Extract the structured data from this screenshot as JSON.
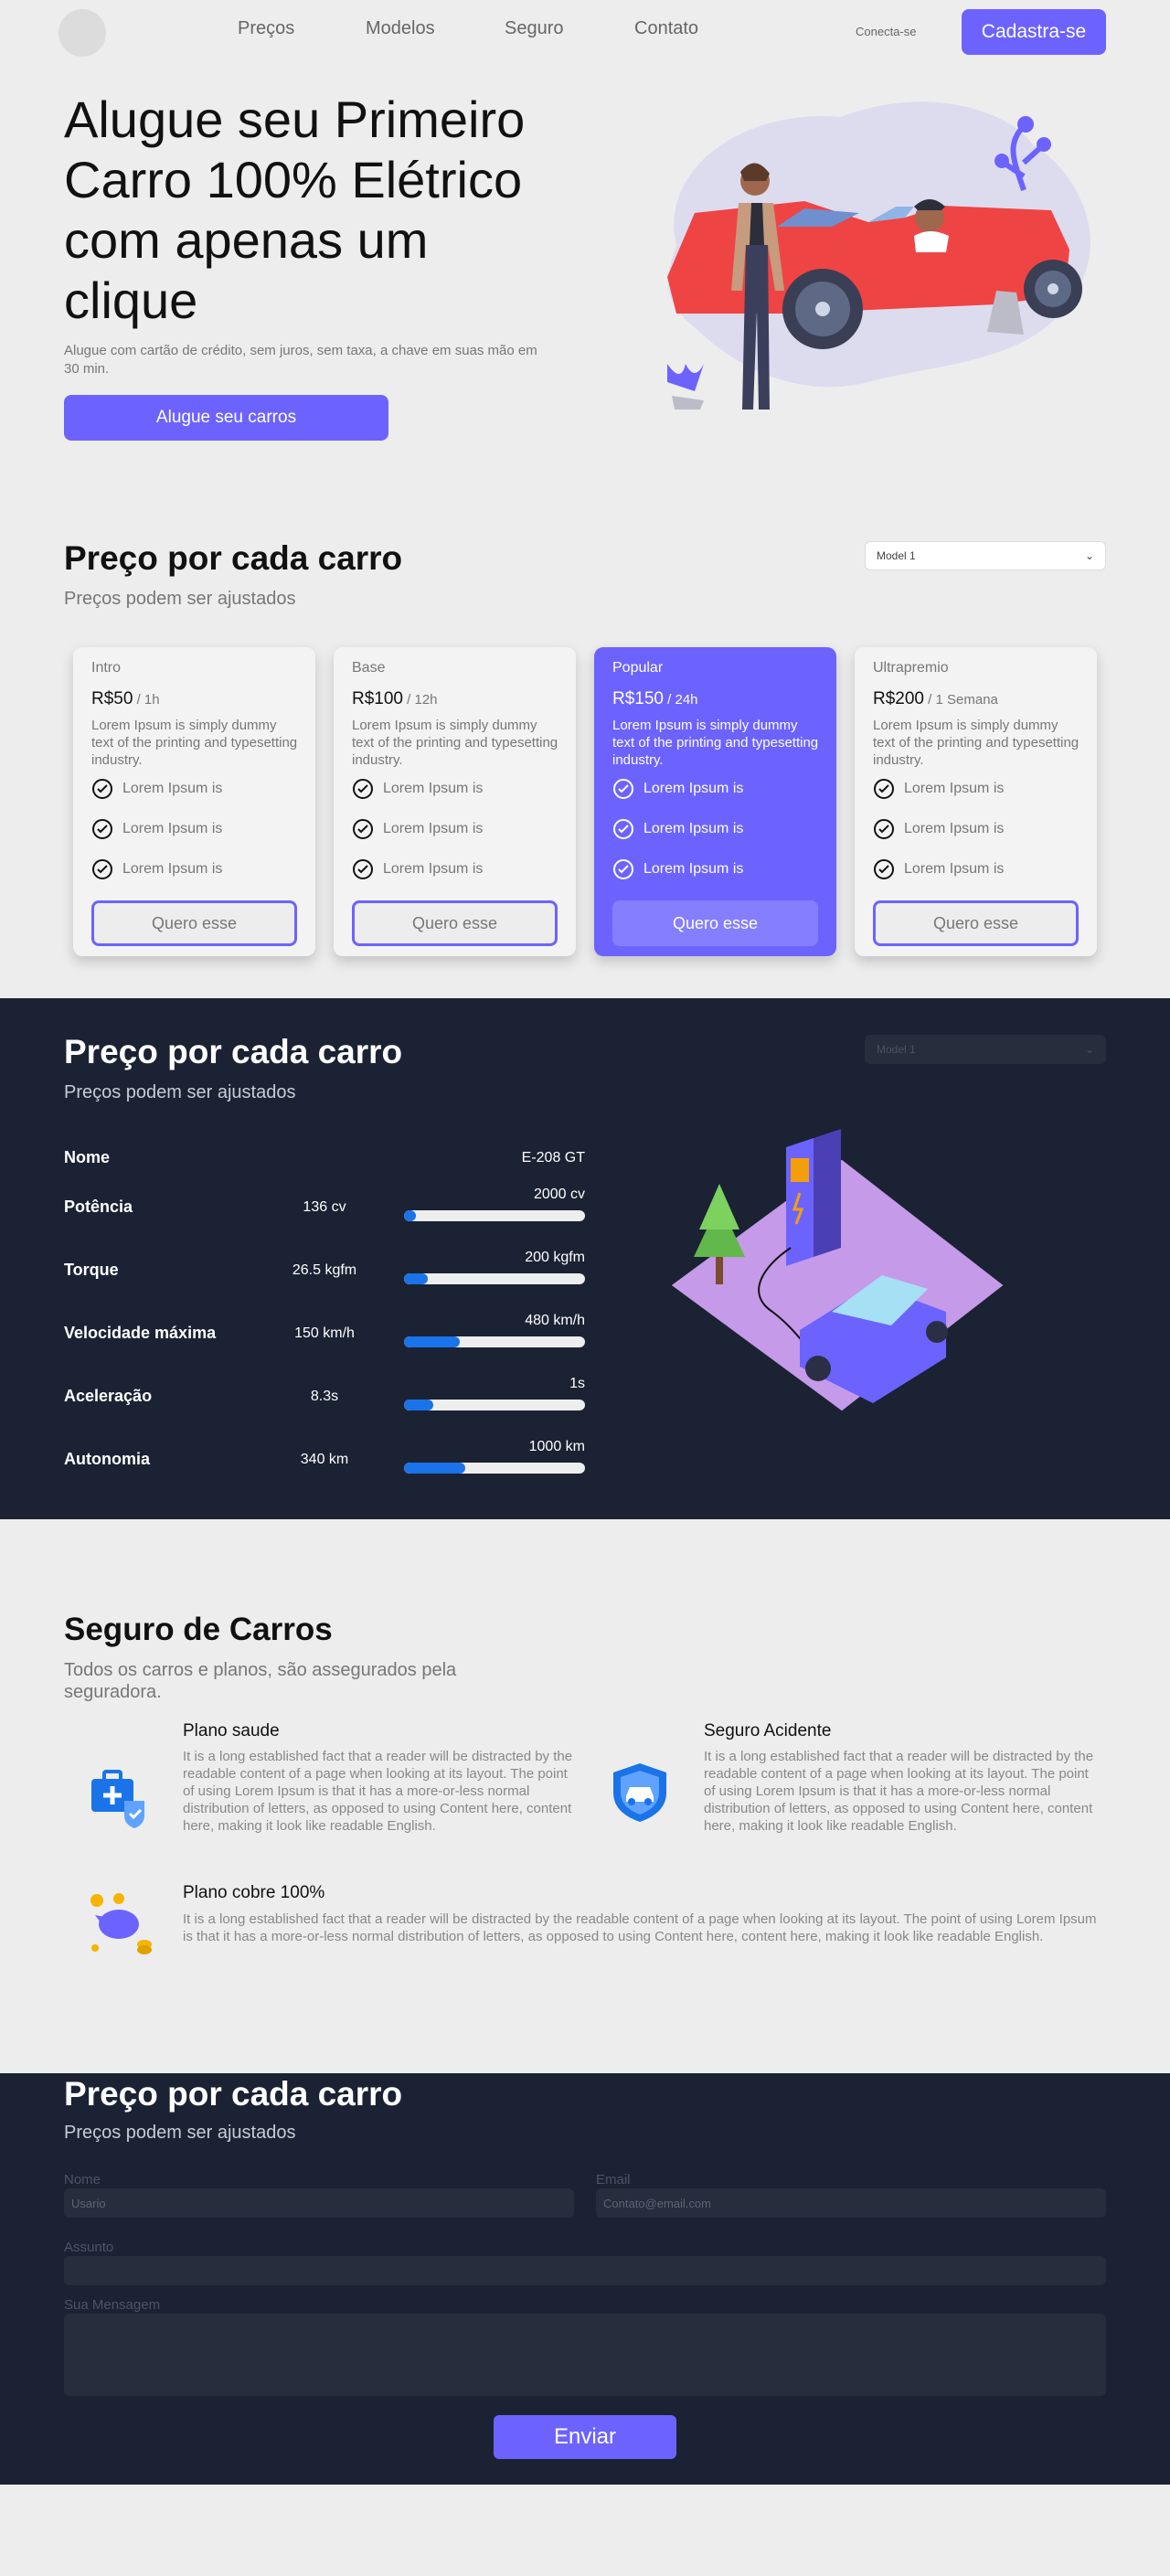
{
  "nav": {
    "links": [
      "Preços",
      "Modelos",
      "Seguro",
      "Contato"
    ],
    "login": "Conecta-se",
    "signup": "Cadastra-se"
  },
  "hero": {
    "title": "Alugue seu Primeiro Carro 100% Elétrico com apenas um clique",
    "subtitle": "Alugue com cartão de crédito, sem juros, sem taxa, a chave em suas mão em 30 min.",
    "button": "Alugue seu carros"
  },
  "pricing": {
    "title": "Preço por cada carro",
    "subtitle": "Preços podem ser ajustados",
    "select": "Model 1",
    "cards": [
      {
        "tier": "Intro",
        "price": "R$50",
        "period": " / 1h",
        "desc": "Lorem Ipsum is simply dummy text of the printing and typesetting industry.",
        "features": [
          "Lorem Ipsum is",
          "Lorem Ipsum is",
          "Lorem Ipsum is"
        ],
        "button": "Quero esse"
      },
      {
        "tier": "Base",
        "price": "R$100",
        "period": " / 12h",
        "desc": "Lorem Ipsum is simply dummy text of the printing and typesetting industry.",
        "features": [
          "Lorem Ipsum is",
          "Lorem Ipsum is",
          "Lorem Ipsum is"
        ],
        "button": "Quero esse"
      },
      {
        "tier": "Popular",
        "price": "R$150",
        "period": " / 24h",
        "desc": "Lorem Ipsum is simply dummy text of the printing and typesetting industry.",
        "features": [
          "Lorem Ipsum is",
          "Lorem Ipsum is",
          "Lorem Ipsum is"
        ],
        "button": "Quero esse"
      },
      {
        "tier": "Ultrapremio",
        "price": "R$200",
        "period": " / 1 Semana",
        "desc": "Lorem Ipsum is simply dummy text of the printing and typesetting industry.",
        "features": [
          "Lorem Ipsum is",
          "Lorem Ipsum is",
          "Lorem Ipsum is"
        ],
        "button": "Quero esse"
      }
    ]
  },
  "specs": {
    "title": "Preço por cada carro",
    "subtitle": "Preços podem ser ajustados",
    "select": "Model 1",
    "name_label": "Nome",
    "name_value": "E-208 GT",
    "rows": [
      {
        "label": "Potência",
        "value": "136 cv",
        "max": "2000 cv",
        "fraction": 0.068
      },
      {
        "label": "Torque",
        "value": "26.5 kgfm",
        "max": "200 kgfm",
        "fraction": 0.13
      },
      {
        "label": "Velocidade máxima",
        "value": "150 km/h",
        "max": "480 km/h",
        "fraction": 0.31
      },
      {
        "label": "Aceleração",
        "value": "8.3s",
        "max": "1s",
        "fraction": 0.16
      },
      {
        "label": "Autonomia",
        "value": "340 km",
        "max": "1000 km",
        "fraction": 0.34
      }
    ],
    "accent": "#1a73e8"
  },
  "insurance": {
    "title": "Seguro de Carros",
    "subtitle": "Todos os carros e planos, são assegurados pela seguradora.",
    "items": [
      {
        "title": "Plano saude",
        "text": "It is a long established fact that a reader will be distracted by the readable content of a page when looking at its layout. The point of using Lorem Ipsum is that it has a more-or-less normal distribution of letters, as opposed to using Content here, content here, making it look like readable English.",
        "icon": "medical-kit-icon"
      },
      {
        "title": "Seguro Acidente",
        "text": "It is a long established fact that a reader will be distracted by the readable content of a page when looking at its layout. The point of using Lorem Ipsum is that it has a more-or-less normal distribution of letters, as opposed to using Content here, content here, making it look like readable English.",
        "icon": "car-shield-icon"
      },
      {
        "title": "Plano cobre 100%",
        "text": "It is a long established fact that a reader will be distracted by the readable content of a page when looking at its layout. The point of using Lorem Ipsum is that it has a more-or-less normal distribution of letters, as opposed to using Content here, content here, making it look like readable English.",
        "icon": "piggy-coins-icon"
      }
    ]
  },
  "contact": {
    "title": "Preço por cada carro",
    "subtitle": "Preços podem ser ajustados",
    "name_label": "Nome",
    "name_placeholder": "Usario",
    "email_label": "Email",
    "email_placeholder": "Contato@email.com",
    "subject_label": "Assunto",
    "message_label": "Sua Mensagem",
    "send": "Enviar"
  },
  "colors": {
    "accent": "#6c63ff",
    "dark": "#1a2233",
    "background": "#ededed"
  }
}
